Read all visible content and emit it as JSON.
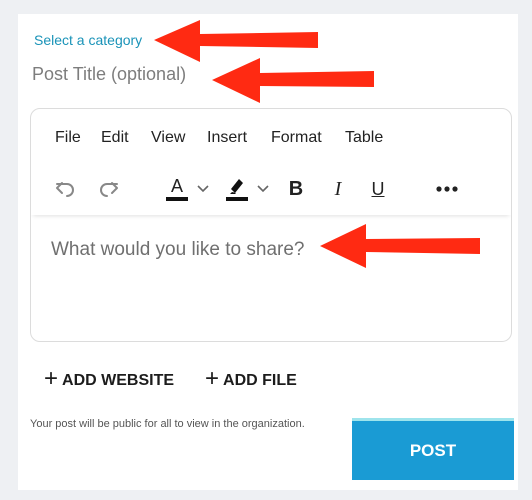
{
  "form": {
    "category_link": "Select a category",
    "title_placeholder": "Post Title (optional)"
  },
  "editor": {
    "menu": [
      "File",
      "Edit",
      "View",
      "Insert",
      "Format",
      "Table"
    ],
    "toolbar": {
      "undo_icon": "undo-icon",
      "redo_icon": "redo-icon",
      "text_color_icon": "text-color-icon",
      "text_color_letter": "A",
      "highlight_icon": "highlight-icon",
      "bold": "B",
      "italic": "I",
      "underline": "U",
      "more_icon": "more-icon"
    },
    "placeholder": "What would you like to share?"
  },
  "actions": {
    "add_website": "ADD WEBSITE",
    "add_file": "ADD FILE",
    "notice": "Your post will be public for all to view in the organization.",
    "post_label": "POST"
  },
  "colors": {
    "link": "#1a93b8",
    "post_button": "#1a9bd4",
    "annotation_arrow": "#ff2a12"
  }
}
